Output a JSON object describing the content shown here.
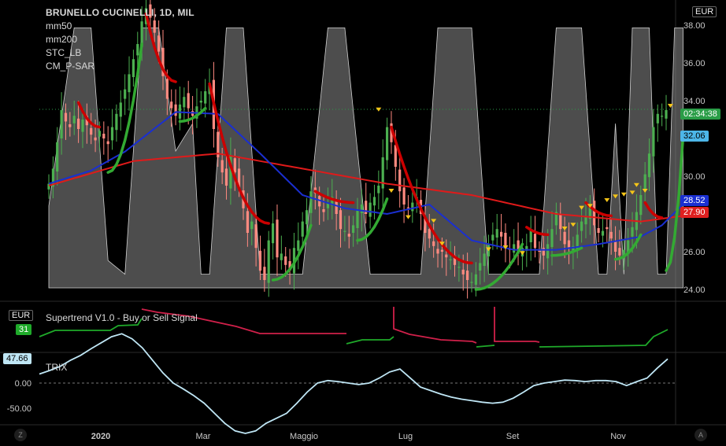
{
  "chart_data": {
    "type": "candlestick",
    "title": "BRUNELLO CUCINELLI, 1D, MIL",
    "currency": "EUR",
    "x_labels": [
      "2020",
      "Mar",
      "Maggio",
      "Lug",
      "Set",
      "Nov"
    ],
    "y_ticks": [
      "24.00",
      "26.00",
      "28.00",
      "30.00",
      "32.00",
      "34.00",
      "36.00",
      "38.00"
    ],
    "indicators": [
      "mm50",
      "mm200",
      "STC_LB",
      "CM_P-SAR"
    ],
    "last_price": "33.54",
    "countdown": "02:34:38",
    "ma_labels": {
      "blue": "28.52",
      "red": "27.90",
      "cyan": "32.06"
    },
    "ylim": [
      23.5,
      39.0
    ],
    "close": [
      29.6,
      30.4,
      31.8,
      33.5,
      32.9,
      32.6,
      33.2,
      32.5,
      33.0,
      32.7,
      32.2,
      31.9,
      32.4,
      32.0,
      31.7,
      32.6,
      33.3,
      33.9,
      34.6,
      35.4,
      36.2,
      37.0,
      38.2,
      38.9,
      38.4,
      37.6,
      36.6,
      35.3,
      34.1,
      33.6,
      33.2,
      33.8,
      34.2,
      33.6,
      33.2,
      33.7,
      34.0,
      34.5,
      34.9,
      32.5,
      31.0,
      30.2,
      29.5,
      31.1,
      30.2,
      29.4,
      28.3,
      27.0,
      27.6,
      26.2,
      25.0,
      24.5,
      26.6,
      27.5,
      25.7,
      25.9,
      25.3,
      25.0,
      26.2,
      26.6,
      27.6,
      28.2,
      29.2,
      29.1,
      28.4,
      28.1,
      28.6,
      28.9,
      28.0,
      27.2,
      27.1,
      26.8,
      27.4,
      28.2,
      28.5,
      28.0,
      28.6,
      28.9,
      29.5,
      31.0,
      32.6,
      31.8,
      30.5,
      29.2,
      28.5,
      28.3,
      28.6,
      28.9,
      28.0,
      27.0,
      26.7,
      26.3,
      25.9,
      26.0,
      25.7,
      25.6,
      25.3,
      25.2,
      24.8,
      24.5,
      24.4,
      24.8,
      25.4,
      25.9,
      26.4,
      26.9,
      27.2,
      26.8,
      26.3,
      26.1,
      26.4,
      25.9,
      26.2,
      26.3,
      27.1,
      26.2,
      26.0,
      25.8,
      26.4,
      27.2,
      28.1,
      27.2,
      26.4,
      26.2,
      26.3,
      26.9,
      27.6,
      27.9,
      28.5,
      27.4,
      27.0,
      27.1,
      27.2,
      26.7,
      26.0,
      25.8,
      26.1,
      26.6,
      27.3,
      28.1,
      29.0,
      30.1,
      31.2,
      32.6,
      33.3,
      33.2,
      33.5
    ],
    "mm50_anchors": [
      [
        0,
        29.6
      ],
      [
        10,
        30.3
      ],
      [
        18,
        31.3
      ],
      [
        30,
        33.4
      ],
      [
        40,
        33.3
      ],
      [
        50,
        31.2
      ],
      [
        60,
        29.0
      ],
      [
        70,
        28.3
      ],
      [
        80,
        28.0
      ],
      [
        90,
        28.5
      ],
      [
        100,
        26.6
      ],
      [
        110,
        26.1
      ],
      [
        120,
        26.1
      ],
      [
        130,
        26.4
      ],
      [
        140,
        26.8
      ],
      [
        145,
        27.4
      ],
      [
        150,
        28.52
      ]
    ],
    "mm200_anchors": [
      [
        0,
        29.5
      ],
      [
        20,
        30.8
      ],
      [
        40,
        31.2
      ],
      [
        60,
        30.4
      ],
      [
        80,
        29.6
      ],
      [
        100,
        29.0
      ],
      [
        120,
        28.0
      ],
      [
        140,
        27.6
      ],
      [
        150,
        27.9
      ]
    ],
    "stc_anchors": [
      [
        0,
        0.3
      ],
      [
        6,
        0.95
      ],
      [
        10,
        0.95
      ],
      [
        14,
        0.1
      ],
      [
        18,
        0.05
      ],
      [
        22,
        0.95
      ],
      [
        26,
        0.95
      ],
      [
        30,
        0.5
      ],
      [
        34,
        0.6
      ],
      [
        36,
        0.05
      ],
      [
        38,
        0.05
      ],
      [
        42,
        0.95
      ],
      [
        46,
        0.95
      ],
      [
        50,
        0.05
      ],
      [
        60,
        0.05
      ],
      [
        66,
        0.95
      ],
      [
        70,
        0.95
      ],
      [
        76,
        0.05
      ],
      [
        88,
        0.05
      ],
      [
        92,
        0.95
      ],
      [
        100,
        0.95
      ],
      [
        104,
        0.05
      ],
      [
        116,
        0.05
      ],
      [
        120,
        0.95
      ],
      [
        126,
        0.95
      ],
      [
        130,
        0.05
      ],
      [
        132,
        0.05
      ],
      [
        134,
        0.6
      ],
      [
        136,
        0.05
      ],
      [
        138,
        0.95
      ],
      [
        142,
        0.95
      ],
      [
        144,
        0.05
      ],
      [
        146,
        0.05
      ],
      [
        148,
        0.95
      ],
      [
        150,
        0.95
      ]
    ],
    "sar_segments": [
      {
        "color": "#cc0000",
        "from": 7,
        "to": 12,
        "y0": 33.9,
        "y1": 32.6
      },
      {
        "color": "#33aa33",
        "from": 14,
        "to": 22,
        "y0": 30.2,
        "y1": 37.0
      },
      {
        "color": "#cc0000",
        "from": 23,
        "to": 30,
        "y0": 38.6,
        "y1": 35.0
      },
      {
        "color": "#33aa33",
        "from": 31,
        "to": 37,
        "y0": 32.9,
        "y1": 33.6
      },
      {
        "color": "#cc0000",
        "from": 38,
        "to": 52,
        "y0": 34.9,
        "y1": 27.5
      },
      {
        "color": "#33aa33",
        "from": 53,
        "to": 62,
        "y0": 24.5,
        "y1": 27.4
      },
      {
        "color": "#cc0000",
        "from": 63,
        "to": 72,
        "y0": 29.2,
        "y1": 28.6
      },
      {
        "color": "#33aa33",
        "from": 73,
        "to": 80,
        "y0": 26.6,
        "y1": 28.8
      },
      {
        "color": "#cc0000",
        "from": 81,
        "to": 100,
        "y0": 32.6,
        "y1": 25.4
      },
      {
        "color": "#33aa33",
        "from": 101,
        "to": 112,
        "y0": 24.0,
        "y1": 26.4
      },
      {
        "color": "#cc0000",
        "from": 113,
        "to": 118,
        "y0": 27.3,
        "y1": 26.9
      },
      {
        "color": "#33aa33",
        "from": 119,
        "to": 126,
        "y0": 25.8,
        "y1": 26.2
      },
      {
        "color": "#cc0000",
        "from": 127,
        "to": 133,
        "y0": 28.6,
        "y1": 27.9
      },
      {
        "color": "#33aa33",
        "from": 134,
        "to": 140,
        "y0": 25.6,
        "y1": 26.9
      },
      {
        "color": "#cc0000",
        "from": 141,
        "to": 145,
        "y0": 28.6,
        "y1": 27.8
      },
      {
        "color": "#33aa33",
        "from": 146,
        "to": 150,
        "y0": 25.0,
        "y1": 32.1
      }
    ],
    "triangles": [
      [
        78,
        33.3
      ],
      [
        81,
        29.0
      ],
      [
        85,
        27.6
      ],
      [
        91,
        27.4
      ],
      [
        93,
        26.2
      ],
      [
        104,
        25.9
      ],
      [
        108,
        26.0
      ],
      [
        112,
        25.7
      ],
      [
        122,
        27.0
      ],
      [
        124,
        27.2
      ],
      [
        126,
        28.1
      ],
      [
        128,
        28.2
      ],
      [
        132,
        28.5
      ],
      [
        134,
        28.7
      ],
      [
        136,
        28.8
      ],
      [
        138,
        28.9
      ],
      [
        139,
        29.3
      ],
      [
        141,
        29.0
      ],
      [
        147,
        33.5
      ]
    ]
  },
  "supertrend": {
    "label": "Supertrend V1.0 - Buy or Sell Signal",
    "badge": "31",
    "currency": "EUR"
  },
  "trix": {
    "label": "TRIX",
    "value_badge": "47.66",
    "y_ticks": [
      "0.00",
      "-50.00"
    ],
    "values": [
      18,
      25,
      33,
      45,
      55,
      68,
      80,
      92,
      98,
      88,
      70,
      45,
      20,
      0,
      -12,
      -25,
      -40,
      -60,
      -80,
      -95,
      -100,
      -95,
      -80,
      -70,
      -60,
      -40,
      -18,
      0,
      5,
      3,
      0,
      -3,
      0,
      10,
      22,
      28,
      10,
      -8,
      -15,
      -22,
      -28,
      -32,
      -35,
      -38,
      -40,
      -38,
      -30,
      -18,
      -5,
      0,
      3,
      6,
      5,
      3,
      5,
      5,
      3,
      -5,
      3,
      10,
      30,
      48
    ]
  },
  "bottom_icons": {
    "left": "Z",
    "right": "A"
  }
}
